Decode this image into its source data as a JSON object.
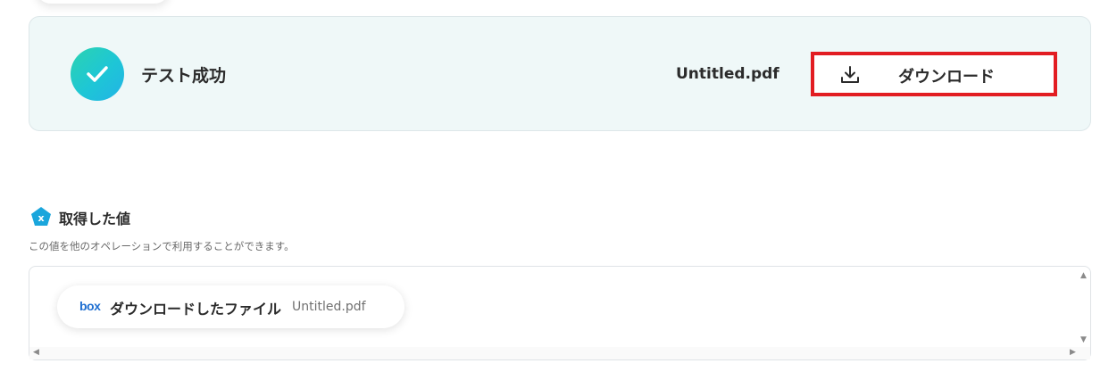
{
  "result": {
    "status_text": "テスト成功",
    "file_name": "Untitled.pdf",
    "download_label": "ダウンロード"
  },
  "section": {
    "title": "取得した値",
    "description": "この値を他のオペレーションで利用することができます。"
  },
  "values": [
    {
      "label": "ダウンロードしたファイル",
      "value": "Untitled.pdf",
      "service_logo": "box"
    }
  ],
  "colors": {
    "success_gradient_start": "#2bd3b0",
    "success_gradient_end": "#22b3e6",
    "highlight_border": "#e21d22",
    "panel_bg": "#eff8f8",
    "box_blue": "#1f6fd1"
  },
  "icons": {
    "success": "checkmark-icon",
    "download": "download-icon",
    "section": "variable-icon"
  }
}
